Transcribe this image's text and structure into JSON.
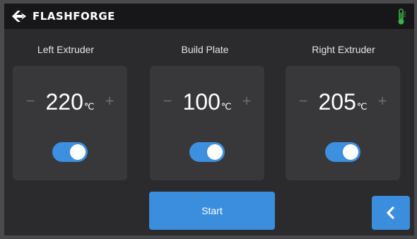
{
  "header": {
    "brand": "FLASHFORGE",
    "logo_icon": "flashforge-logo-icon",
    "status_icon": "thermometer-icon",
    "status_color": "#3bb24a"
  },
  "extruders": [
    {
      "title": "Left Extruder",
      "value": "220",
      "unit": "℃",
      "enabled": true,
      "minus": "−",
      "plus": "+"
    },
    {
      "title": "Build Plate",
      "value": "100",
      "unit": "℃",
      "enabled": true,
      "minus": "−",
      "plus": "+"
    },
    {
      "title": "Right Extruder",
      "value": "205",
      "unit": "℃",
      "enabled": true,
      "minus": "−",
      "plus": "+"
    }
  ],
  "actions": {
    "start_label": "Start",
    "back_icon": "chevron-left-icon"
  },
  "colors": {
    "accent": "#3b8ddd",
    "background": "#2b2b2d",
    "card": "#38383b",
    "topbar": "#17171a"
  }
}
